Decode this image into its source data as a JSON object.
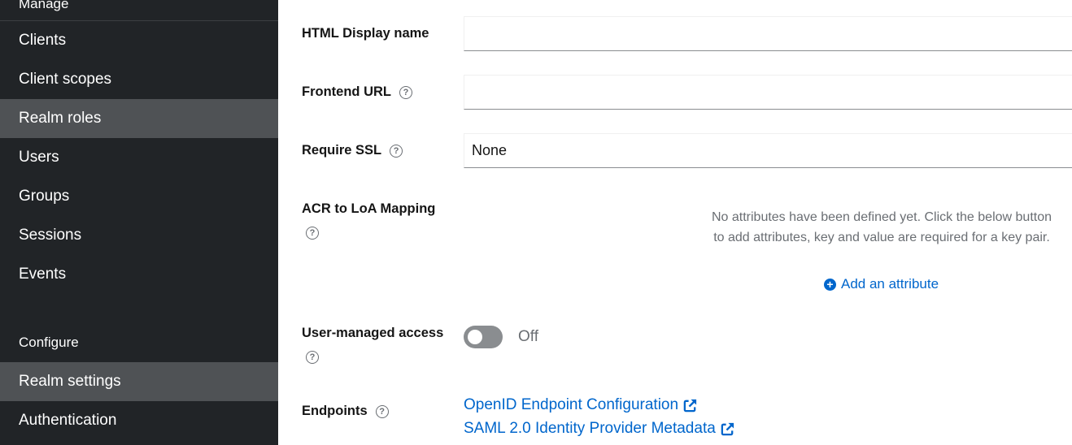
{
  "sidebar": {
    "manage_title": "Manage",
    "configure_title": "Configure",
    "manage_items": [
      {
        "label": "Clients"
      },
      {
        "label": "Client scopes"
      },
      {
        "label": "Realm roles"
      },
      {
        "label": "Users"
      },
      {
        "label": "Groups"
      },
      {
        "label": "Sessions"
      },
      {
        "label": "Events"
      }
    ],
    "configure_items": [
      {
        "label": "Realm settings"
      },
      {
        "label": "Authentication"
      }
    ]
  },
  "form": {
    "html_display_name": {
      "label": "HTML Display name",
      "value": ""
    },
    "frontend_url": {
      "label": "Frontend URL",
      "value": ""
    },
    "require_ssl": {
      "label": "Require SSL",
      "value": "None"
    },
    "acr_mapping": {
      "label": "ACR to LoA Mapping",
      "empty_text": "No attributes have been defined yet. Click the below button to add attributes, key and value are required for a key pair.",
      "add_label": "Add an attribute"
    },
    "user_managed_access": {
      "label": "User-managed access",
      "state": "Off",
      "enabled": false
    },
    "endpoints": {
      "label": "Endpoints",
      "links": [
        {
          "label": "OpenID Endpoint Configuration"
        },
        {
          "label": "SAML 2.0 Identity Provider Metadata"
        }
      ]
    },
    "help_glyph": "?"
  },
  "colors": {
    "sidebar_bg": "#212427",
    "sidebar_active": "#4f5255",
    "link": "#0066cc",
    "muted": "#6a6e73"
  },
  "icons": [
    "help-icon",
    "plus-circle-icon",
    "external-link-icon"
  ]
}
